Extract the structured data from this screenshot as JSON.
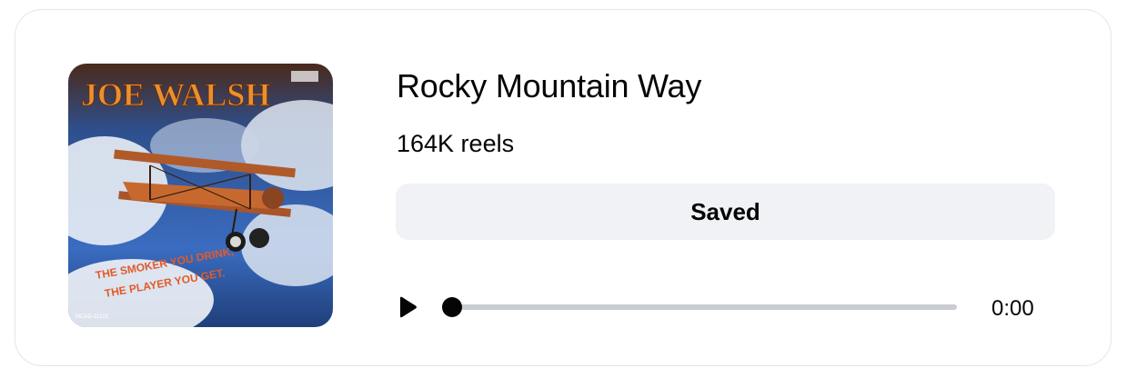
{
  "track": {
    "title": "Rocky Mountain Way",
    "reels": "164K reels"
  },
  "album_art": {
    "artist_text": "JOE WALSH",
    "tagline_line1": "THE SMOKER YOU DRINK,",
    "tagline_line2": "THE PLAYER YOU GET.",
    "catalog": "MCAD-31121"
  },
  "actions": {
    "saved_label": "Saved"
  },
  "player": {
    "time": "0:00",
    "progress": 0,
    "play_icon": "play-icon"
  }
}
